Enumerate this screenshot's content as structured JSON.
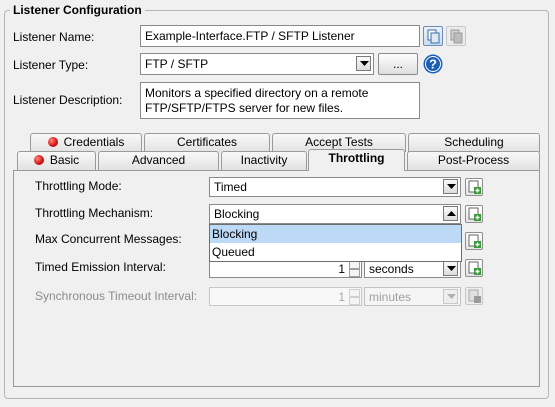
{
  "section_title": "Listener Configuration",
  "listener_name": {
    "label": "Listener Name:",
    "value": "Example-Interface.FTP / SFTP Listener"
  },
  "listener_type": {
    "label": "Listener Type:",
    "value": "FTP / SFTP",
    "browse_label": "..."
  },
  "listener_description": {
    "label": "Listener Description:",
    "value": "Monitors a specified directory on a remote FTP/SFTP/FTPS server for new files."
  },
  "tabs_row1": [
    {
      "label": "Credentials",
      "error": true
    },
    {
      "label": "Certificates",
      "error": false
    },
    {
      "label": "Accept Tests",
      "error": false
    },
    {
      "label": "Scheduling",
      "error": false
    }
  ],
  "tabs_row2": [
    {
      "label": "Basic",
      "error": true
    },
    {
      "label": "Advanced",
      "error": false
    },
    {
      "label": "Inactivity",
      "error": false
    },
    {
      "label": "Throttling",
      "error": false,
      "active": true
    },
    {
      "label": "Post-Process",
      "error": false
    }
  ],
  "throttling": {
    "mode": {
      "label": "Throttling Mode:",
      "value": "Timed"
    },
    "mechanism": {
      "label": "Throttling Mechanism:",
      "value": "Blocking",
      "options": [
        "Blocking",
        "Queued"
      ],
      "selected": "Blocking"
    },
    "max_concurrent": {
      "label": "Max Concurrent Messages:"
    },
    "timed_emission": {
      "label": "Timed Emission Interval:",
      "value": "1",
      "unit": "seconds"
    },
    "sync_timeout": {
      "label": "Synchronous Timeout Interval:",
      "value": "1",
      "unit": "minutes",
      "disabled": true
    }
  },
  "icons": {
    "copy": "copy-icon",
    "paste": "paste-icon",
    "help": "help-icon",
    "add_variable": "add-variable-icon"
  },
  "colors": {
    "error_dot": "#d01010",
    "selection": "#bcd9f5",
    "help": "#1a5fb4"
  }
}
